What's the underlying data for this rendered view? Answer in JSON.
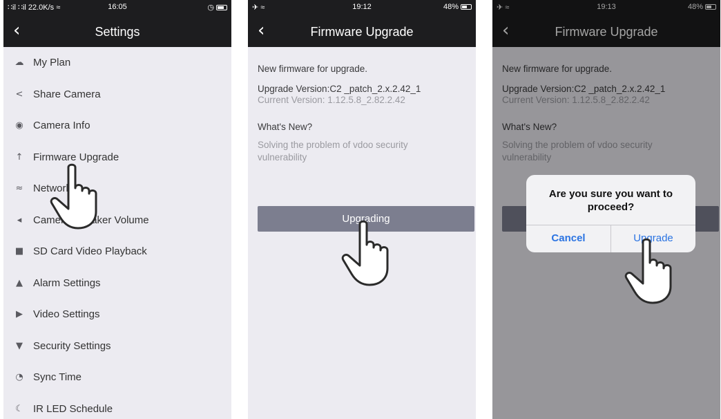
{
  "screen1": {
    "status": {
      "left": "∷il ∷il 22.0K/s ≈",
      "time": "16:05",
      "right": "◷"
    },
    "nav": {
      "back": "‹",
      "title": "Settings"
    },
    "menu": [
      {
        "icon": "cloud-icon",
        "glyph": "☁",
        "label": "My Plan"
      },
      {
        "icon": "share-icon",
        "glyph": "<",
        "label": "Share Camera"
      },
      {
        "icon": "camera-info-icon",
        "glyph": "◉",
        "label": "Camera Info"
      },
      {
        "icon": "arrow-up-icon",
        "glyph": "↑",
        "label": "Firmware Upgrade"
      },
      {
        "icon": "wifi-icon",
        "glyph": "≈",
        "label": "Network"
      },
      {
        "icon": "speaker-icon",
        "glyph": "◂",
        "label": "Camera Speaker Volume"
      },
      {
        "icon": "sd-card-icon",
        "glyph": "■",
        "label": "SD Card Video Playback"
      },
      {
        "icon": "alarm-icon",
        "glyph": "▲",
        "label": "Alarm Settings"
      },
      {
        "icon": "video-icon",
        "glyph": "▶",
        "label": "Video Settings"
      },
      {
        "icon": "shield-icon",
        "glyph": "▼",
        "label": "Security Settings"
      },
      {
        "icon": "clock-icon",
        "glyph": "◔",
        "label": "Sync Time"
      },
      {
        "icon": "ir-led-icon",
        "glyph": "☾",
        "label": "IR LED Schedule"
      }
    ]
  },
  "screen2": {
    "status": {
      "left": "✈ ≈",
      "time": "19:12",
      "right": "48%"
    },
    "nav": {
      "back": "‹",
      "title": "Firmware Upgrade"
    },
    "new_firmware": "New firmware for upgrade.",
    "upgrade_version": "Upgrade Version:C2 _patch_2.x.2.42_1",
    "current_version": "Current Version: 1.12.5.8_2.82.2.42",
    "whats_new": "What's New?",
    "notes": "Solving the problem of vdoo security vulnerability",
    "button": "Upgrading"
  },
  "screen3": {
    "status": {
      "left": "✈ ≈",
      "time": "19:13",
      "right": "48%"
    },
    "nav": {
      "back": "‹",
      "title": "Firmware Upgrade"
    },
    "new_firmware": "New firmware for upgrade.",
    "upgrade_version": "Upgrade Version:C2 _patch_2.x.2.42_1",
    "current_version": "Current Version: 1.12.5.8_2.82.2.42",
    "whats_new": "What's New?",
    "notes": "Solving the problem of vdoo security vulnerability",
    "dialog": {
      "message": "Are you sure you want to proceed?",
      "cancel": "Cancel",
      "confirm": "Upgrade"
    }
  }
}
